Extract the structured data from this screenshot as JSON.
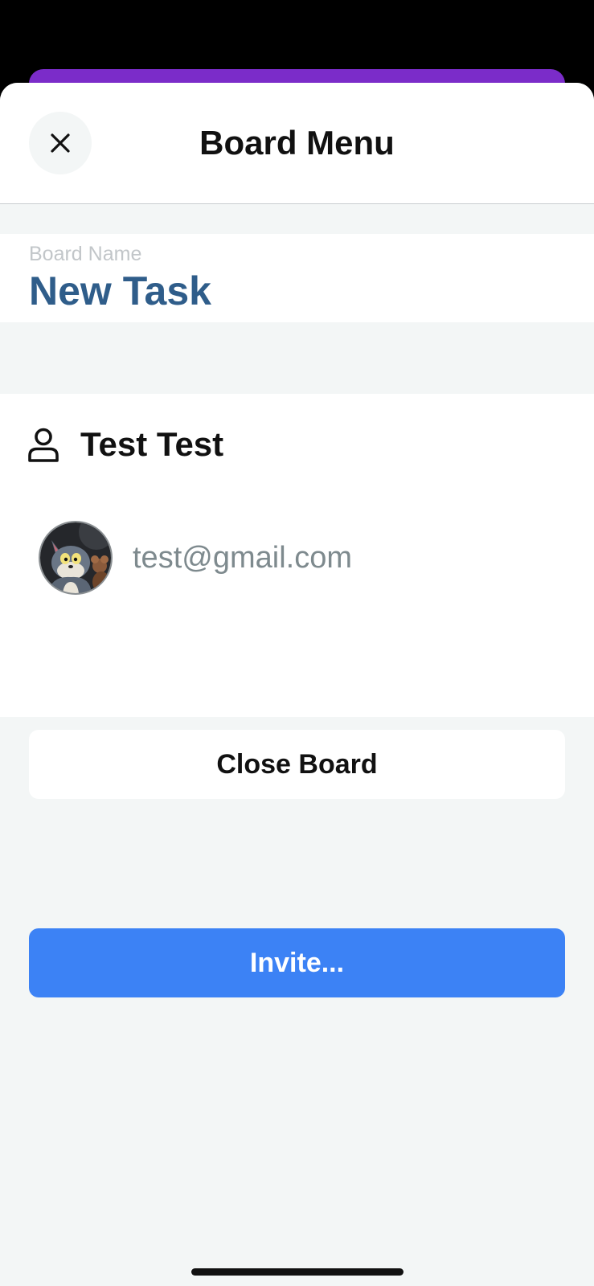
{
  "colors": {
    "background_card_behind": "#7B2CC9",
    "sheet_background": "#F3F6F6",
    "board_name_color": "#2F5D8A",
    "invite_button": "#3C82F5",
    "email_color": "#7E8A8E"
  },
  "header": {
    "title": "Board Menu",
    "close_icon": "close-icon"
  },
  "board": {
    "name_label": "Board Name",
    "name_value": "New Task"
  },
  "members": {
    "owner_icon": "user-icon",
    "owner_name": "Test Test",
    "list": [
      {
        "email": "test@gmail.com",
        "avatar": "avatar"
      }
    ]
  },
  "actions": {
    "invite_label": "Invite...",
    "close_board_label": "Close Board"
  }
}
